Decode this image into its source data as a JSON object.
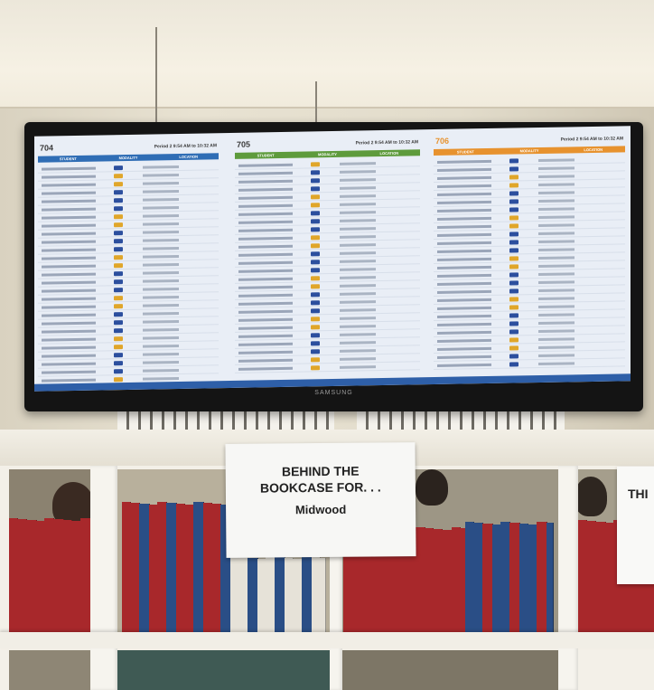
{
  "display": {
    "brand": "SAMSUNG",
    "panels": [
      {
        "room": "704",
        "period": "Period 2 9:54 AM to 10:32 AM",
        "color": "#2f6db5",
        "columns": [
          "STUDENT",
          "MODALITY",
          "LOCATION"
        ],
        "rows": 28
      },
      {
        "room": "705",
        "period": "Period 2 9:54 AM to 10:32 AM",
        "color": "#5e9b3c",
        "columns": [
          "STUDENT",
          "MODALITY",
          "LOCATION"
        ],
        "rows": 26
      },
      {
        "room": "706",
        "period": "Period 2 9:54 AM to 10:32 AM",
        "color": "#e7922e",
        "columns": [
          "STUDENT",
          "MODALITY",
          "LOCATION"
        ],
        "rows": 26
      }
    ],
    "modality_colors": [
      "#2c4f9e",
      "#e0a62a",
      "#2c4f9e",
      "#e0a62a",
      "#2c4f9e"
    ]
  },
  "sign": {
    "line1": "BEHIND THE",
    "line2": "BOOKCASE FOR. . .",
    "line3": "Midwood"
  },
  "sign_partial": {
    "text": "THI"
  },
  "colors": {
    "book_red": "#a8282b",
    "book_blue": "#2a4e86",
    "book_white": "#e6e2d8"
  }
}
